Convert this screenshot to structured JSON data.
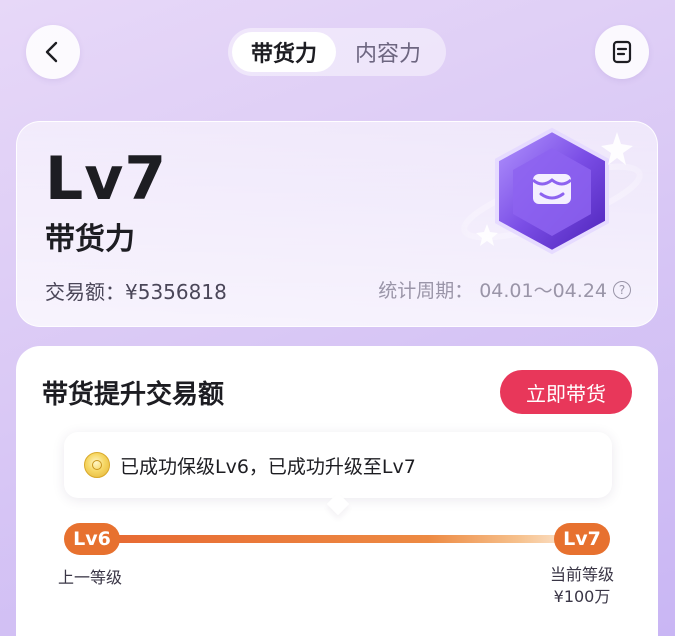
{
  "header": {
    "tabs": [
      {
        "label": "带货力",
        "active": true
      },
      {
        "label": "内容力",
        "active": false
      }
    ]
  },
  "level_card": {
    "level": "Lv7",
    "name": "带货力",
    "amount_label": "交易额：",
    "amount_value": "¥5356818",
    "period_label": "统计周期：",
    "period_value": "04.01～04.24"
  },
  "progress": {
    "title": "带货提升交易额",
    "action_label": "立即带货",
    "tip_text": "已成功保级Lv6，已成功升级至Lv7",
    "left_level": "Lv6",
    "right_level": "Lv7",
    "left_caption": "上一等级",
    "right_caption": "当前等级",
    "right_value": "¥100万",
    "fill": 1.0
  },
  "colors": {
    "accent_red": "#e8375a",
    "accent_orange": "#e7712f"
  }
}
